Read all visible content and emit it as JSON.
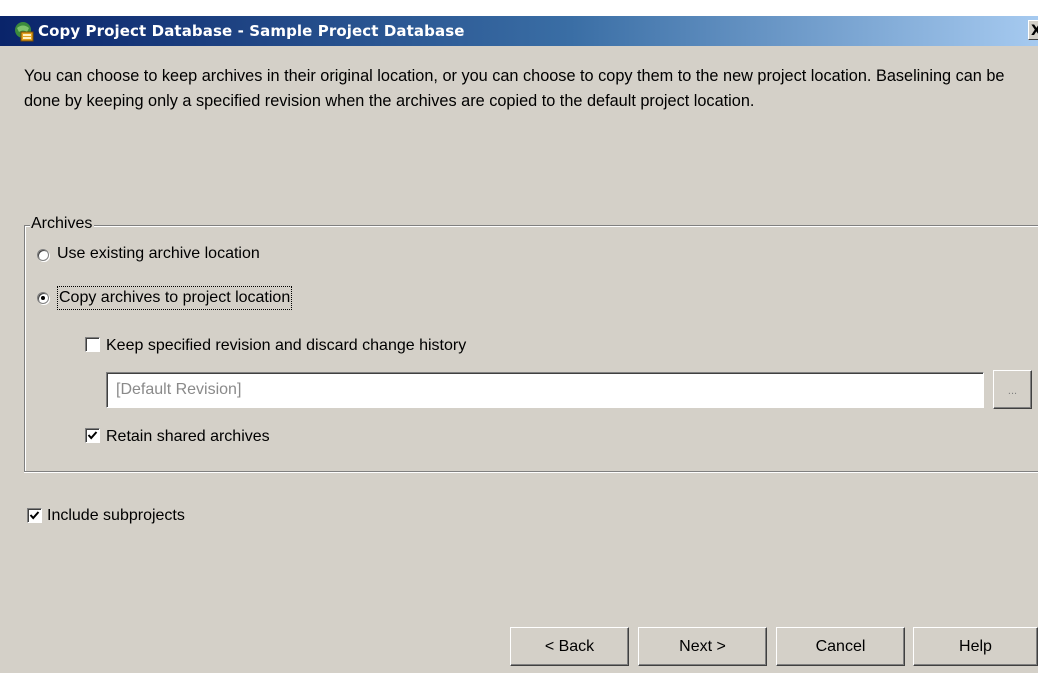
{
  "window": {
    "title": "Copy Project Database - Sample Project Database",
    "close_glyph": "X"
  },
  "description": "You can choose to keep archives in their original location, or you can choose to copy them to the new project location.  Baselining can be done by keeping only a specified revision when the archives are copied to the default project location.",
  "archives": {
    "group_label": "Archives",
    "use_existing": {
      "label": "Use existing archive location",
      "selected": false
    },
    "copy_to_project": {
      "label": "Copy archives to project location",
      "selected": true
    },
    "keep_revision": {
      "label": "Keep specified revision and discard change history",
      "checked": false
    },
    "revision_field": {
      "value": "[Default Revision]"
    },
    "browse_label": "...",
    "retain_shared": {
      "label": "Retain shared archives",
      "checked": true
    }
  },
  "include_subprojects": {
    "label": "Include subprojects",
    "checked": true
  },
  "buttons": {
    "back": "< Back",
    "next": "Next >",
    "cancel": "Cancel",
    "help": "Help"
  },
  "colors": {
    "titlebar_start": "#0a246a",
    "titlebar_end": "#a6caf0",
    "dialog_bg": "#d4d0c8",
    "disabled_text": "#8a8a8a"
  },
  "icons": {
    "app": "project-database-icon",
    "check": "check-mark-icon"
  }
}
